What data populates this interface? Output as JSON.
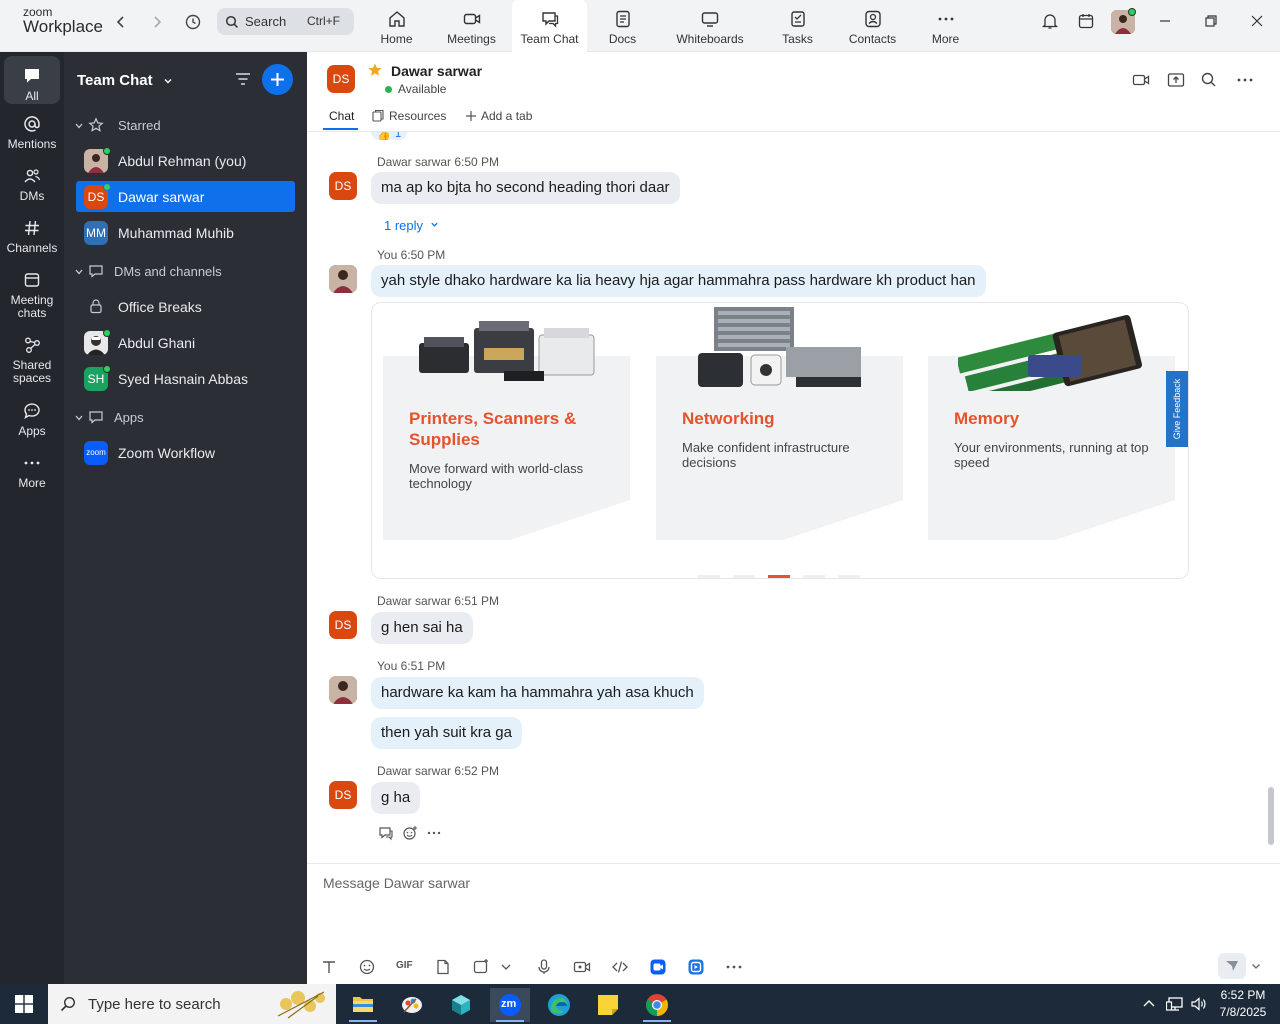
{
  "app": {
    "brand_top": "zoom",
    "brand_bottom": "Workplace"
  },
  "search": {
    "label": "Search",
    "shortcut": "Ctrl+F"
  },
  "nav_tabs": [
    {
      "label": "Home",
      "icon": "home-icon"
    },
    {
      "label": "Meetings",
      "icon": "video-camera-icon"
    },
    {
      "label": "Team Chat",
      "icon": "chat-bubble-icon",
      "active": true
    },
    {
      "label": "Docs",
      "icon": "document-icon"
    },
    {
      "label": "Whiteboards",
      "icon": "whiteboard-icon"
    },
    {
      "label": "Tasks",
      "icon": "tasks-icon"
    },
    {
      "label": "Contacts",
      "icon": "contacts-icon"
    },
    {
      "label": "More",
      "icon": "more-dots-icon"
    }
  ],
  "rail": [
    {
      "label": "All",
      "icon": "chat-all-icon",
      "active": true
    },
    {
      "label": "Mentions",
      "icon": "at-icon"
    },
    {
      "label": "DMs",
      "icon": "people-icon"
    },
    {
      "label": "Channels",
      "icon": "hash-icon"
    },
    {
      "label": "Meeting chats",
      "label_line1": "Meeting",
      "label_line2": "chats",
      "icon": "calendar-icon"
    },
    {
      "label": "Shared spaces",
      "label_line1": "Shared",
      "label_line2": "spaces",
      "icon": "shared-spaces-icon"
    },
    {
      "label": "Apps",
      "icon": "apps-icon"
    },
    {
      "label": "More",
      "icon": "more-dots-icon"
    }
  ],
  "sidebar": {
    "title": "Team Chat",
    "sections": [
      {
        "label": "Starred",
        "icon": "star-outline-icon"
      },
      {
        "label": "DMs and channels",
        "icon": "chat-outline-icon"
      },
      {
        "label": "Apps",
        "icon": "chat-outline-icon"
      }
    ],
    "starred": [
      {
        "name": "Abdul Rehman (you)",
        "avatar": "photo",
        "online": true
      },
      {
        "name": "Dawar sarwar",
        "initials": "DS",
        "avatar_color": "#d9480f",
        "online": true,
        "active": true
      },
      {
        "name": "Muhammad Muhib",
        "initials": "MM",
        "avatar_color": "#2f6fb3"
      }
    ],
    "dms": [
      {
        "name": "Office Breaks",
        "icon": "lock-icon"
      },
      {
        "name": "Abdul Ghani",
        "avatar": "photo",
        "online": true
      },
      {
        "name": "Syed Hasnain Abbas",
        "initials": "SH",
        "avatar_color": "#1aa260",
        "online": true
      }
    ],
    "apps": [
      {
        "name": "Zoom Workflow",
        "initials": "zoom",
        "avatar_color": "#0b5cff"
      }
    ]
  },
  "chat": {
    "initials": "DS",
    "name": "Dawar sarwar",
    "status": "Available",
    "tabs": {
      "chat": "Chat",
      "resources": "Resources",
      "add": "Add a tab"
    },
    "reaction_count": "1",
    "messages": [
      {
        "sender": "Dawar sarwar",
        "time": "6:50 PM",
        "text": "ma ap ko bjta ho second heading thori daar",
        "reply_label": "1 reply"
      },
      {
        "sender": "You",
        "time": "6:50 PM",
        "text": "yah style dhako hardware ka lia heavy hja agar hammahra pass hardware kh product han"
      },
      {
        "sender": "Dawar sarwar",
        "time": "6:51 PM",
        "text": "g hen sai ha"
      },
      {
        "sender": "You",
        "time": "6:51 PM",
        "text": "hardware ka kam ha hammahra yah asa khuch",
        "text2": "then yah suit kra ga"
      },
      {
        "sender": "Dawar sarwar",
        "time": "6:52 PM",
        "text": "g ha"
      }
    ],
    "preview_cards": [
      {
        "title": "Printers, Scanners & Supplies",
        "desc": "Move forward with world-class technology"
      },
      {
        "title": "Networking",
        "desc": "Make confident infrastructure decisions"
      },
      {
        "title": "Memory",
        "desc": "Your environments, running at top speed"
      }
    ],
    "preview_feedback": "Give Feedback",
    "composer_placeholder": "Message Dawar sarwar",
    "composer_tools": [
      "text-format-icon",
      "emoji-icon",
      "gif-icon",
      "file-icon",
      "screenshot-icon",
      "chevron-down-icon",
      "microphone-icon",
      "video-clip-icon",
      "code-icon",
      "app-icon",
      "app-icon",
      "more-dots-icon"
    ],
    "gif_label": "GIF"
  },
  "taskbar": {
    "search_placeholder": "Type here to search",
    "time": "6:52 PM",
    "date": "7/8/2025",
    "apps": [
      "file-explorer-icon",
      "app-icon",
      "app-icon",
      "zoom-icon",
      "edge-icon",
      "sticky-notes-icon",
      "chrome-icon"
    ],
    "zoom_label": "zm"
  },
  "colors": {
    "accent": "#0e71eb",
    "avatar_ds": "#d9480f",
    "sidebar": "#2b2f35",
    "rail": "#23272d",
    "preview_title": "#e5532d"
  }
}
